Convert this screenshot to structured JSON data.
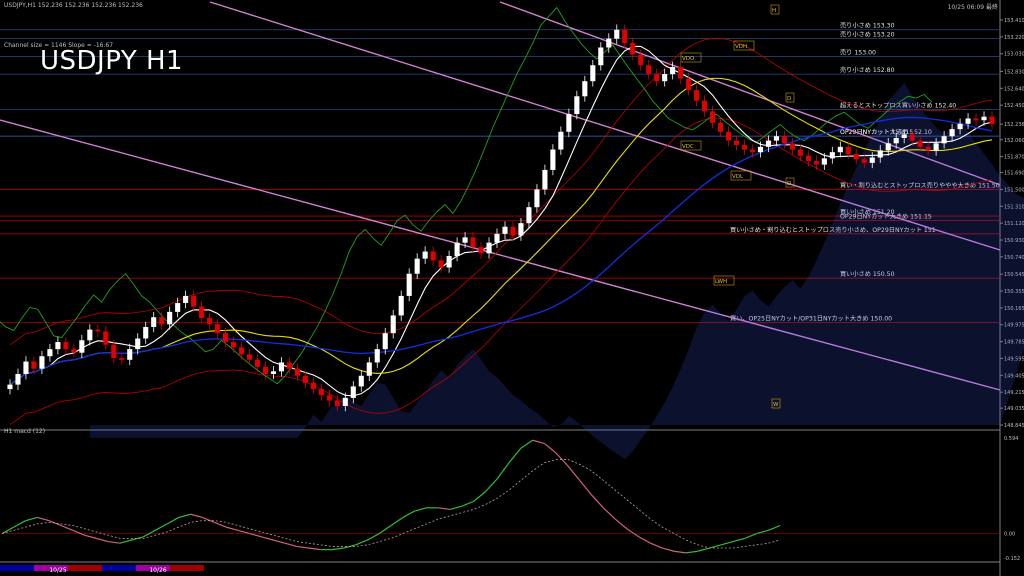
{
  "header": {
    "left": "USDJPY,H1  152.236 152.236 152.236 152.236",
    "right": "10/25 06:09 最終"
  },
  "channel_info": "Channel size = 1146  Slope = -16.67",
  "title": "USDJPY H1",
  "macd_label": "H1  macd (12)",
  "colors": {
    "bull": "#ffffff",
    "bear": "#e00000",
    "level_red": "#b00000",
    "level_blue": "#2a4a8a",
    "channel": "#d080d0",
    "ma_fast": "#ffffff",
    "ma_mid": "#e8e000",
    "ma_slow": "#1030e0",
    "bb": "#c00000",
    "green": "#20a020",
    "macd_main": "#30c030",
    "macd_down": "#d06080",
    "macd_signal": "#c0a0a0",
    "cloud": "#4060ff"
  },
  "chart_data": [
    {
      "type": "candlestick",
      "symbol": "USDJPY",
      "timeframe": "H1",
      "ylim": [
        148.845,
        153.5
      ],
      "y_ticks": [
        "153.410",
        "153.220",
        "153.030",
        "152.830",
        "152.640",
        "152.450",
        "152.236",
        "152.060",
        "151.870",
        "151.690",
        "151.500",
        "151.310",
        "151.120",
        "150.930",
        "150.740",
        "150.545",
        "150.355",
        "150.165",
        "149.975",
        "149.785",
        "149.595",
        "149.405",
        "149.215",
        "149.035",
        "148.845"
      ],
      "x_labels": [
        "10/25",
        "10/26"
      ],
      "x_label_index": [
        34,
        106
      ],
      "bars_count": 200,
      "closes": [
        149.3,
        149.42,
        149.56,
        149.48,
        149.62,
        149.7,
        149.78,
        149.7,
        149.66,
        149.8,
        149.92,
        149.9,
        149.75,
        149.6,
        149.58,
        149.7,
        149.82,
        149.95,
        150.06,
        149.98,
        150.12,
        150.22,
        150.3,
        150.18,
        150.05,
        149.98,
        149.88,
        149.78,
        149.72,
        149.64,
        149.58,
        149.5,
        149.42,
        149.45,
        149.55,
        149.48,
        149.4,
        149.32,
        149.25,
        149.18,
        149.12,
        149.06,
        149.15,
        149.28,
        149.4,
        149.55,
        149.7,
        149.88,
        150.08,
        150.3,
        150.55,
        150.72,
        150.8,
        150.7,
        150.62,
        150.75,
        150.9,
        150.96,
        150.85,
        150.78,
        150.9,
        151.0,
        151.08,
        150.98,
        151.12,
        151.3,
        151.5,
        151.72,
        151.95,
        152.15,
        152.35,
        152.55,
        152.72,
        152.9,
        153.1,
        153.2,
        153.3,
        153.15,
        153.02,
        152.9,
        152.8,
        152.72,
        152.8,
        152.88,
        152.75,
        152.62,
        152.5,
        152.38,
        152.25,
        152.15,
        152.05,
        152.0,
        151.95,
        151.92,
        151.98,
        152.05,
        152.1,
        152.02,
        151.95,
        151.88,
        151.82,
        151.78,
        151.85,
        151.92,
        151.98,
        151.9,
        151.84,
        151.8,
        151.86,
        151.94,
        152.02,
        152.08,
        152.12,
        152.05,
        151.98,
        151.94,
        152.02,
        152.1,
        152.18,
        152.24,
        152.3,
        152.28,
        152.32,
        152.236
      ],
      "levels": [
        {
          "price": "153.30",
          "label": "売り小さめ 153.30",
          "color": "level_blue"
        },
        {
          "price": "153.20",
          "label": "売り小さめ 153.20",
          "color": "level_blue"
        },
        {
          "price": "153.00",
          "label": "売り 153.00",
          "color": "level_blue"
        },
        {
          "price": "152.80",
          "label": "売り小さめ 152.80",
          "color": "level_blue"
        },
        {
          "price": "152.40",
          "label": "超えるとストップロス買い小さめ 152.40",
          "color": "level_blue"
        },
        {
          "price": "152.10",
          "label": "OP29日NYカット大きめ 152.10",
          "color": "level_blue"
        },
        {
          "price": "152.10",
          "label": "OP29日NYカット 152.15",
          "color": "level_blue"
        },
        {
          "price": "151.50",
          "label": "買い・割り込むとストップロス売りややや大きめ 151.50",
          "color": "level_red"
        },
        {
          "price": "151.20",
          "label": "買い小さめ 151.20",
          "color": "level_red"
        },
        {
          "price": "151.15",
          "label": "OP29日NYカット大きめ 151.15",
          "color": "level_red"
        },
        {
          "price": "151.00",
          "label": "買い小さめ・割り込むとストップロス売り小さめ、OP29日NYカット 151",
          "color": "level_red"
        },
        {
          "price": "150.50",
          "label": "買い小さめ 150.50",
          "color": "level_red"
        },
        {
          "price": "150.00",
          "label": "買い、OP25日NYカット/OP31日NYカット大きめ 150.00",
          "color": "level_red"
        }
      ],
      "markers": [
        "VDH",
        "VDO",
        "VDC",
        "VDL",
        "LWH",
        "LWL",
        "D",
        "H",
        "W"
      ]
    },
    {
      "type": "line",
      "name": "macd",
      "ylim": [
        -0.152,
        0.594
      ],
      "y_ticks": [
        "0.594",
        "0.00",
        "-0.152"
      ],
      "values": [
        0.0,
        0.04,
        0.08,
        0.1,
        0.08,
        0.05,
        0.02,
        -0.01,
        -0.03,
        -0.05,
        -0.06,
        -0.04,
        -0.02,
        0.02,
        0.06,
        0.1,
        0.12,
        0.1,
        0.07,
        0.04,
        0.02,
        0.0,
        -0.02,
        -0.04,
        -0.06,
        -0.08,
        -0.09,
        -0.1,
        -0.1,
        -0.09,
        -0.07,
        -0.04,
        0.0,
        0.05,
        0.1,
        0.14,
        0.16,
        0.16,
        0.15,
        0.17,
        0.2,
        0.26,
        0.34,
        0.44,
        0.53,
        0.58,
        0.56,
        0.5,
        0.42,
        0.33,
        0.24,
        0.16,
        0.09,
        0.03,
        -0.02,
        -0.06,
        -0.09,
        -0.11,
        -0.12,
        -0.11,
        -0.09,
        -0.07,
        -0.05,
        -0.03,
        0.0,
        0.02,
        0.05
      ],
      "signal": [
        0.0,
        0.02,
        0.04,
        0.06,
        0.07,
        0.06,
        0.05,
        0.03,
        0.01,
        -0.01,
        -0.03,
        -0.03,
        -0.03,
        -0.01,
        0.01,
        0.04,
        0.07,
        0.08,
        0.08,
        0.07,
        0.05,
        0.03,
        0.01,
        -0.01,
        -0.03,
        -0.05,
        -0.06,
        -0.07,
        -0.08,
        -0.08,
        -0.08,
        -0.07,
        -0.05,
        -0.03,
        0.0,
        0.03,
        0.06,
        0.09,
        0.11,
        0.13,
        0.15,
        0.18,
        0.22,
        0.27,
        0.33,
        0.39,
        0.44,
        0.46,
        0.46,
        0.43,
        0.39,
        0.33,
        0.27,
        0.21,
        0.15,
        0.09,
        0.04,
        0.0,
        -0.04,
        -0.07,
        -0.09,
        -0.09,
        -0.09,
        -0.08,
        -0.07,
        -0.06,
        -0.04
      ]
    }
  ]
}
